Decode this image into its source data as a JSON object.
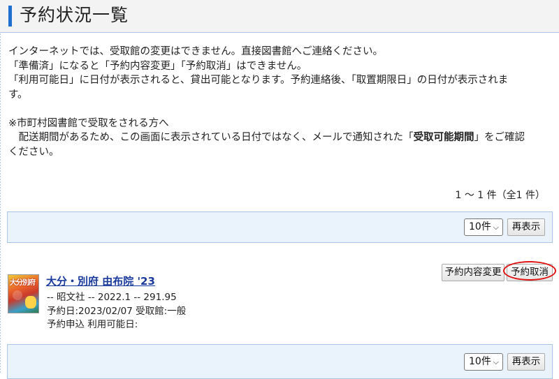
{
  "page": {
    "title": "予約状況一覧"
  },
  "notice": {
    "line1": "インターネットでは、受取館の変更はできません。直接図書館へご連絡ください。",
    "line2": "「準備済」になると「予約内容変更」「予約取消」はできません。",
    "line3": "「利用可能日」に日付が表示されると、貸出可能となります。予約連絡後、「取置期限日」の日付が表示されま",
    "line3b": "す。",
    "line4": "※市町村図書館で受取をされる方へ",
    "line5_pre": "　配送期間があるため、この画面に表示されている日付ではなく、メールで通知された「",
    "line5_bold": "受取可能期間",
    "line5_post": "」をご確認",
    "line6": "ください。"
  },
  "result_count": "1 ～ 1 件（全1 件）",
  "pager_top": {
    "per_page": "10件",
    "refresh_label": "再表示"
  },
  "pager_bottom": {
    "per_page": "10件",
    "refresh_label": "再表示"
  },
  "reservation": {
    "cover_text": "大分別府",
    "title": "大分・別府 由布院 '23",
    "publisher_line": "-- 昭文社 -- 2022.1 -- 291.95",
    "reserve_line": "予約日:2023/02/07 受取館:一般",
    "status_line": "予約申込 利用可能日:",
    "change_label": "予約内容変更",
    "cancel_label": "予約取消"
  },
  "colors": {
    "accent": "#1f6fd1",
    "pager_bg": "#eaf2fb",
    "highlight": "#e01010",
    "link": "#1a3a9c"
  }
}
